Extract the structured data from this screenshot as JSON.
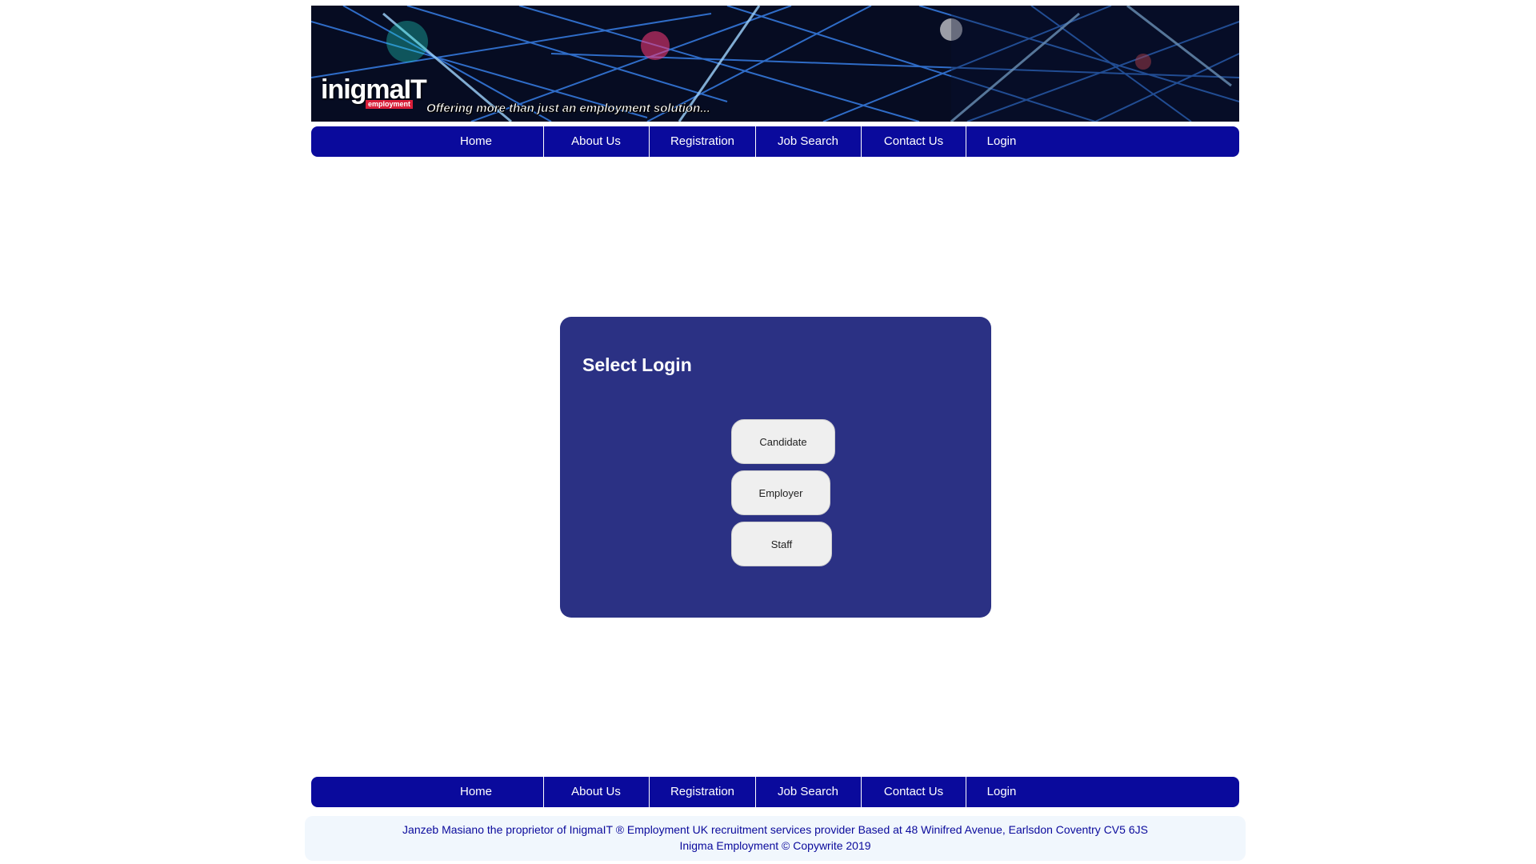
{
  "banner": {
    "brand_name": "inigmaIT",
    "brand_sub": "employment",
    "tagline": "Offering more than just an employment solution..."
  },
  "nav": {
    "items": [
      {
        "label": "Home"
      },
      {
        "label": "About Us"
      },
      {
        "label": "Registration"
      },
      {
        "label": "Job Search"
      },
      {
        "label": "Contact Us"
      },
      {
        "label": "Login"
      }
    ]
  },
  "login": {
    "title": "Select Login",
    "buttons": {
      "candidate": "Candidate",
      "employer": "Employer",
      "staff": "Staff"
    }
  },
  "footer": {
    "line1": "Janzeb Masiano the proprietor of InigmaIT ® Employment UK recruitment services provider Based at 48 Winifred Avenue, Earlsdon Coventry CV5 6JS",
    "line2": "Inigma Employment © Copywrite 2019"
  },
  "colors": {
    "nav_bg": "#0a0a9c",
    "panel_bg": "#2b3184",
    "footer_bg": "#f1f7fd",
    "footer_text": "#0a0a9c",
    "button_bg": "#efefef",
    "brand_accent": "#d91f3a"
  }
}
